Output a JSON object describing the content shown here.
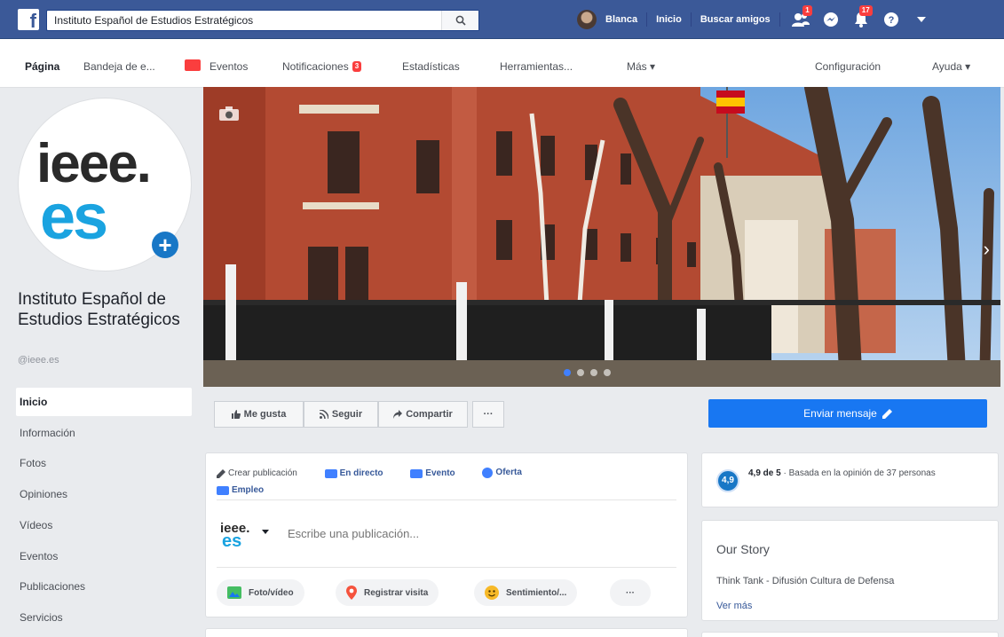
{
  "topbar": {
    "search_value": "Instituto Español de Estudios Estratégicos",
    "user_name": "Blanca",
    "home_label": "Inicio",
    "find_friends_label": "Buscar amigos",
    "friend_badge": "1",
    "notif_badge": "17"
  },
  "pagenav": {
    "pagina": "Página",
    "bandeja": "Bandeja de e...",
    "eventos": "Eventos",
    "notificaciones": "Notificaciones",
    "notif_count": "3",
    "estadisticas": "Estadísticas",
    "herramientas": "Herramientas...",
    "mas": "Más ▾",
    "configuracion": "Configuración",
    "ayuda": "Ayuda ▾"
  },
  "profile": {
    "logo_top": "ieee.",
    "logo_bottom": "es",
    "plus": "+",
    "name": "Instituto Español de Estudios Estratégicos",
    "handle": "@ieee.es"
  },
  "sidebar": {
    "items": [
      {
        "label": "Inicio"
      },
      {
        "label": "Información"
      },
      {
        "label": "Fotos"
      },
      {
        "label": "Opiniones"
      },
      {
        "label": "Vídeos"
      },
      {
        "label": "Eventos"
      },
      {
        "label": "Publicaciones"
      },
      {
        "label": "Servicios"
      }
    ]
  },
  "actions": {
    "like": "Me gusta",
    "follow": "Seguir",
    "share": "Compartir",
    "more": "···",
    "send_message": "Enviar mensaje"
  },
  "composer": {
    "create": "Crear publicación",
    "live": "En directo",
    "event": "Evento",
    "offer": "Oferta",
    "job": "Empleo",
    "placeholder": "Escribe una publicación...",
    "photo": "Foto/vídeo",
    "checkin": "Registrar visita",
    "feeling": "Sentimiento/...",
    "more": "···"
  },
  "rating": {
    "score": "4,9",
    "bold": "4,9 de 5",
    "text": " · Basada en la opinión de 37 personas"
  },
  "story": {
    "title": "Our Story",
    "text": "Think Tank - Difusión Cultura de Defensa",
    "more": "Ver más"
  },
  "colors": {
    "topbar": "#3b5998",
    "accent": "#1877f2",
    "logo_blue": "#1aa3e0"
  }
}
